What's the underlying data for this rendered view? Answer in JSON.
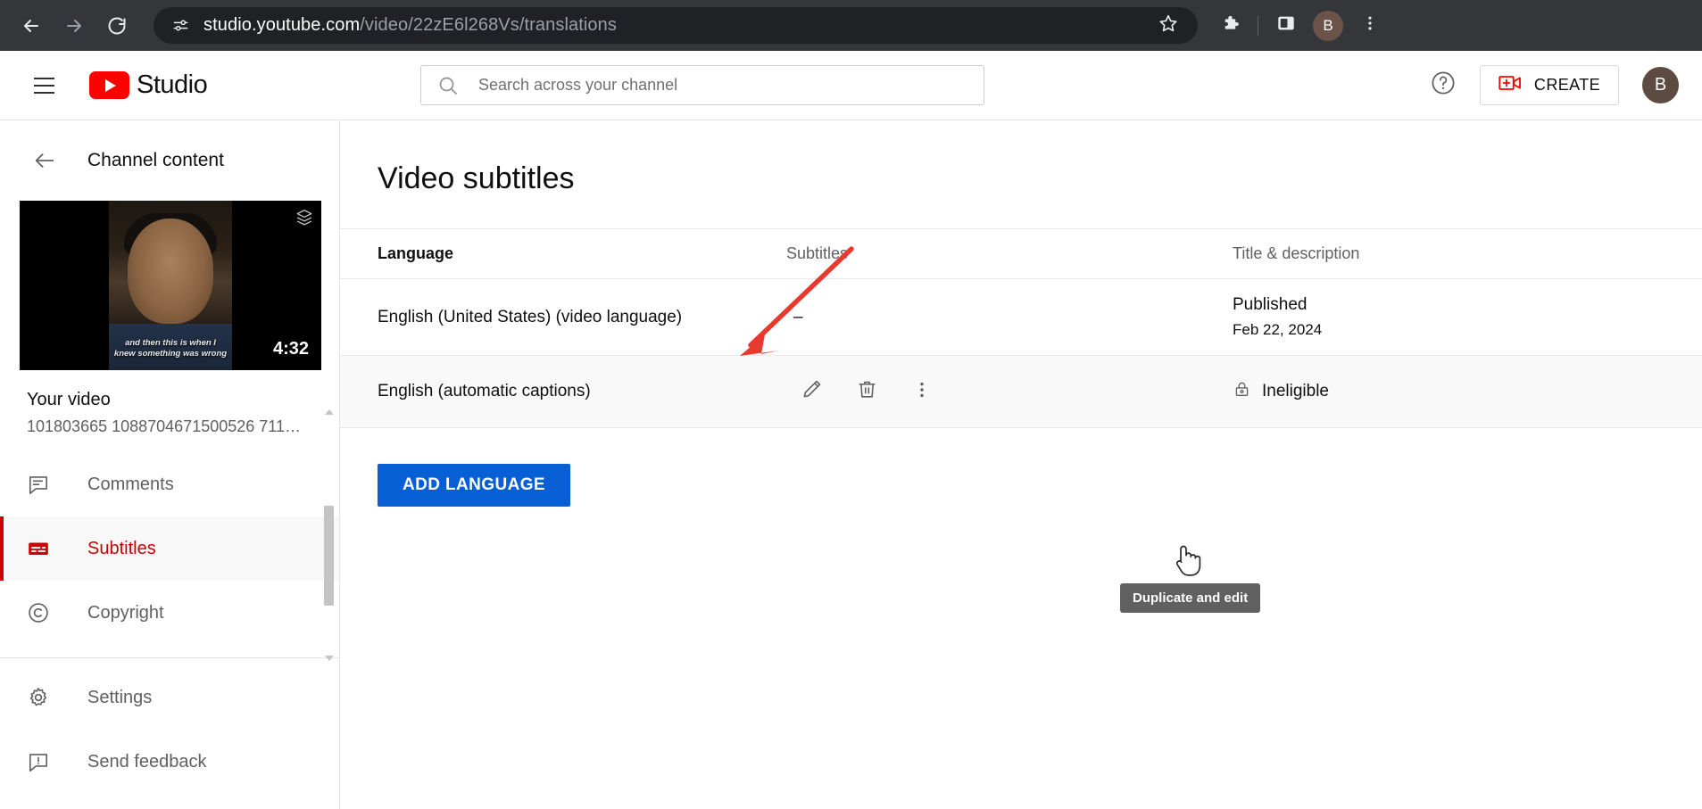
{
  "browser": {
    "back_icon": "back-arrow-icon",
    "forward_icon": "forward-arrow-icon",
    "reload_icon": "reload-icon",
    "site_info_icon": "site-settings-icon",
    "url_domain": "studio.youtube.com",
    "url_path": "/video/22zE6l268Vs/translations",
    "bookmark_icon": "star-icon",
    "extensions_icon": "puzzle-piece-icon",
    "side_panel_icon": "side-panel-icon",
    "profile_initial": "B",
    "menu_icon": "three-dot-menu-icon",
    "toolbar_bg": "#35363a",
    "omnibox_bg": "#202124"
  },
  "header": {
    "menu_icon": "hamburger-menu-icon",
    "logo_text": "Studio",
    "logo_color": "#ff0000",
    "search_placeholder": "Search across your channel",
    "search_value": "",
    "search_icon": "search-icon",
    "help_icon": "help-question-icon",
    "create_label": "CREATE",
    "create_icon": "create-video-icon",
    "avatar_initial": "B"
  },
  "sidebar": {
    "back_icon": "back-arrow-icon",
    "back_label": "Channel content",
    "thumbnail": {
      "caption_line1": "and then this is when I",
      "caption_line2": "knew something was wrong",
      "duration": "4:32",
      "badge_icon": "stack-layers-icon"
    },
    "video_name": "Your video",
    "video_id": "101803665 1088704671500526 711…",
    "items": [
      {
        "label": "Comments",
        "icon": "comment-icon",
        "name": "sidebar-item-comments",
        "active": false
      },
      {
        "label": "Subtitles",
        "icon": "subtitles-icon",
        "name": "sidebar-item-subtitles",
        "active": true
      },
      {
        "label": "Copyright",
        "icon": "copyright-icon",
        "name": "sidebar-item-copyright",
        "active": false
      }
    ],
    "footer_items": [
      {
        "label": "Settings",
        "icon": "gear-icon",
        "name": "sidebar-item-settings"
      },
      {
        "label": "Send feedback",
        "icon": "send-feedback-icon",
        "name": "sidebar-item-send-feedback"
      }
    ],
    "active_color": "#cc0000"
  },
  "main": {
    "page_title": "Video subtitles",
    "table": {
      "headers": {
        "language": "Language",
        "subtitles": "Subtitles",
        "title_description": "Title & description"
      },
      "rows": [
        {
          "language": "English (United States) (video language)",
          "subtitles": "–",
          "status_main": "Published",
          "status_sub": "Feb 22, 2024"
        },
        {
          "language": "English (automatic captions)",
          "subtitles": "",
          "status_main": "Ineligible",
          "status_icon": "lock-icon",
          "actions": [
            {
              "icon": "pencil-edit-icon",
              "name": "duplicate-and-edit-button"
            },
            {
              "icon": "trash-delete-icon",
              "name": "delete-button"
            },
            {
              "icon": "three-dot-menu-icon",
              "name": "more-options-button"
            }
          ]
        }
      ]
    },
    "add_language_label": "ADD LANGUAGE",
    "add_language_color": "#065fd4",
    "tooltip_text": "Duplicate and edit",
    "tooltip_bg": "#606060",
    "annotation_arrow_color": "#e8392f"
  }
}
